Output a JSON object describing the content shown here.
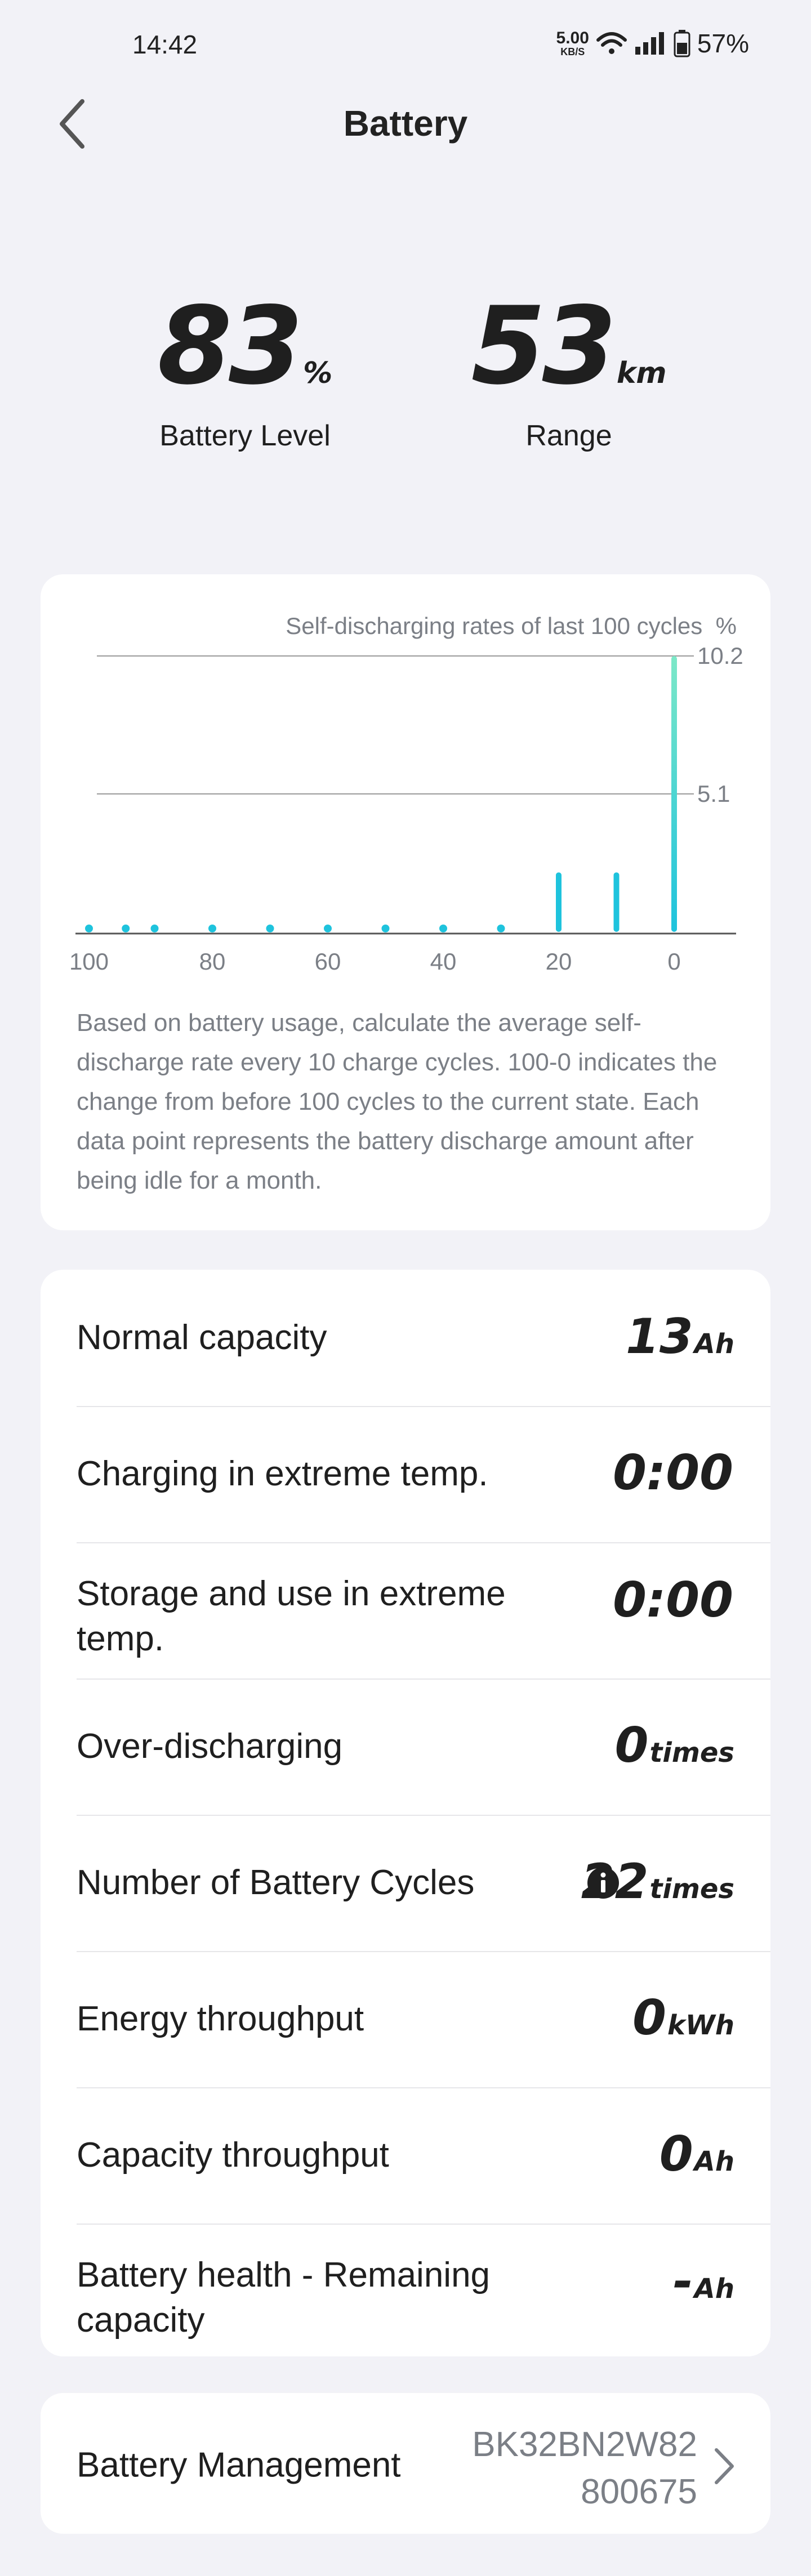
{
  "status_bar": {
    "time": "14:42",
    "net_speed_value": "5.00",
    "net_speed_unit": "KB/S",
    "battery_percent": "57%"
  },
  "header": {
    "title": "Battery"
  },
  "stats": {
    "battery_level": {
      "value": "83",
      "unit": "%",
      "label": "Battery Level"
    },
    "range": {
      "value": "53",
      "unit": "km",
      "label": "Range"
    }
  },
  "chart_data": {
    "type": "bar",
    "title": "Self-discharging rates of last 100 cycles",
    "ylabel": "%",
    "x": [
      100,
      95,
      90,
      80,
      70,
      60,
      50,
      40,
      30,
      20,
      10,
      0
    ],
    "values": [
      0,
      0,
      0,
      0,
      0,
      0,
      0,
      0,
      0,
      2.2,
      2.2,
      10.2
    ],
    "x_ticks": [
      "100",
      "80",
      "60",
      "40",
      "20",
      "0"
    ],
    "y_ticks": [
      "10.2",
      "5.1"
    ],
    "ylim": [
      0,
      10.2
    ],
    "xlim": [
      100,
      0
    ],
    "grid": true,
    "colors": {
      "bar": "#1ec3dd",
      "bar_top": "#7de8c8",
      "axis": "#555555",
      "grid": "#9a9a9a"
    }
  },
  "chart_note": "Based on battery usage, calculate the average self-discharge rate every 10 charge cycles. 100-0 indicates the change from before 100 cycles to the current state. Each data point represents the battery discharge amount after being idle for a month.",
  "metrics": [
    {
      "label": "Normal capacity",
      "value": "13",
      "unit": "Ah"
    },
    {
      "label": "Charging in extreme temp.",
      "value": "0:00",
      "unit": ""
    },
    {
      "label": "Storage and use in extreme temp.",
      "value": "0:00",
      "unit": ""
    },
    {
      "label": "Over-discharging",
      "value": "0",
      "unit": "times"
    },
    {
      "label": "Number of Battery Cycles",
      "value": "22",
      "unit": "times",
      "icon": "info-icon"
    },
    {
      "label": "Energy throughput",
      "value": "0",
      "unit": "kWh"
    },
    {
      "label": "Capacity throughput",
      "value": "0",
      "unit": "Ah"
    },
    {
      "label": "Battery health - Remaining capacity",
      "value": "-",
      "unit": "Ah"
    }
  ],
  "battery_management": {
    "label": "Battery Management",
    "serial_line1": "BK32BN2W82",
    "serial_line2": "800675"
  }
}
